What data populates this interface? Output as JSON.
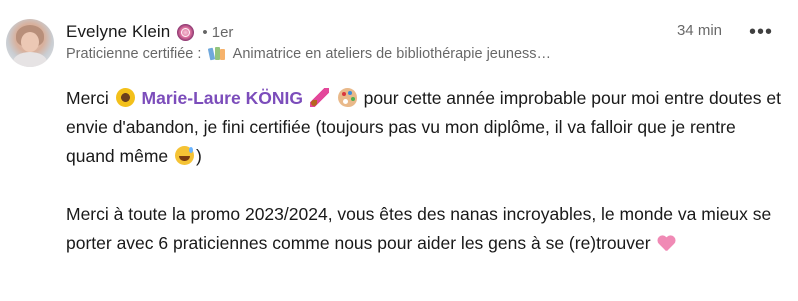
{
  "comment": {
    "author_name": "Evelyne Klein",
    "connection_degree": "• 1er",
    "timestamp": "34 min",
    "more_label": "•••",
    "headline_prefix": "Praticienne certifiée :",
    "headline_text": "Animatrice en ateliers de bibliothérapie jeuness…",
    "body": {
      "p1_start": "Merci",
      "mention": "Marie-Laure KÖNIG",
      "p1_after_mention": "pour cette année improbable pour moi entre doutes et envie d'abandon, je fini certifiée (toujours pas vu mon diplôme, il va falloir que je rentre quand même",
      "p1_end": ")",
      "p2": "Merci à toute la promo 2023/2024, vous êtes des nanas incroyables, le monde va mieux se porter avec 6 praticiennes comme nous pour aider les gens à se (re)trouver"
    },
    "icons": {
      "badge": "profile-badge-icon",
      "books": "books-icon",
      "sunflower": "sunflower-emoji",
      "brush": "paintbrush-emoji",
      "palette": "palette-emoji",
      "grin": "grinning-sweat-emoji",
      "heart": "pink-heart-emoji"
    },
    "colors": {
      "mention": "#7c4dbb",
      "secondary_text": "#666666"
    }
  }
}
